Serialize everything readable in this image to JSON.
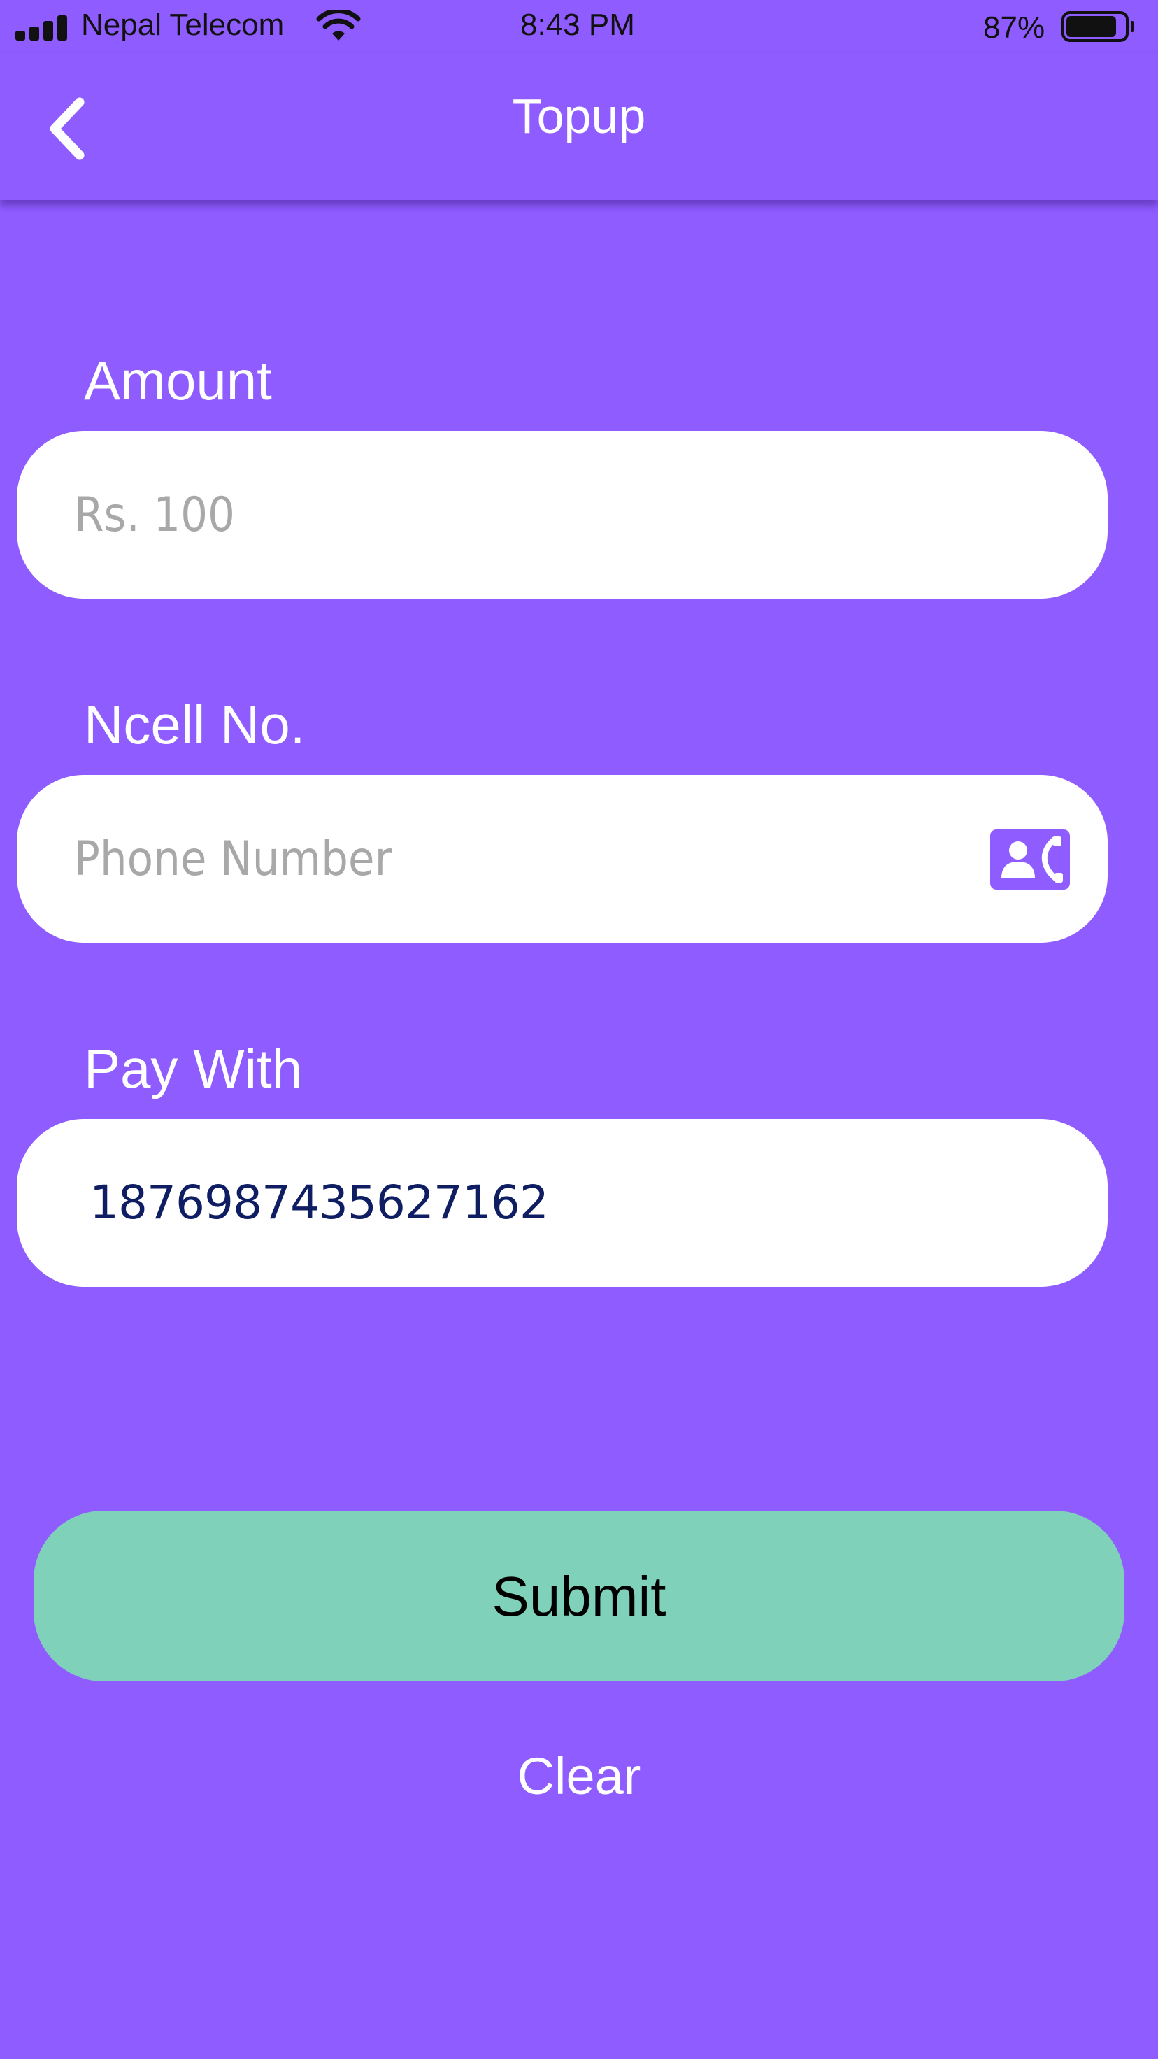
{
  "status_bar": {
    "carrier": "Nepal Telecom",
    "time": "8:43 PM",
    "battery_percent": "87%",
    "battery_level": 0.87,
    "signal_bars": 4,
    "icons": [
      "signal-bars-icon",
      "wifi-icon",
      "battery-icon"
    ]
  },
  "header": {
    "title": "Topup",
    "back_icon": "chevron-left-icon"
  },
  "form": {
    "amount": {
      "label": "Amount",
      "placeholder": "Rs. 100",
      "value": ""
    },
    "phone": {
      "label": "Ncell No.",
      "placeholder": "Phone Number",
      "value": "",
      "icon": "contact-card-icon"
    },
    "pay_with": {
      "label": "Pay With",
      "value": "1876987435627162"
    }
  },
  "actions": {
    "submit_label": "Submit",
    "clear_label": "Clear"
  },
  "colors": {
    "background": "#8f5cff",
    "field": "#ffffff",
    "submit": "#7fd1b9",
    "value_text": "#0f1e63",
    "placeholder_text": "#a8a8a8"
  }
}
